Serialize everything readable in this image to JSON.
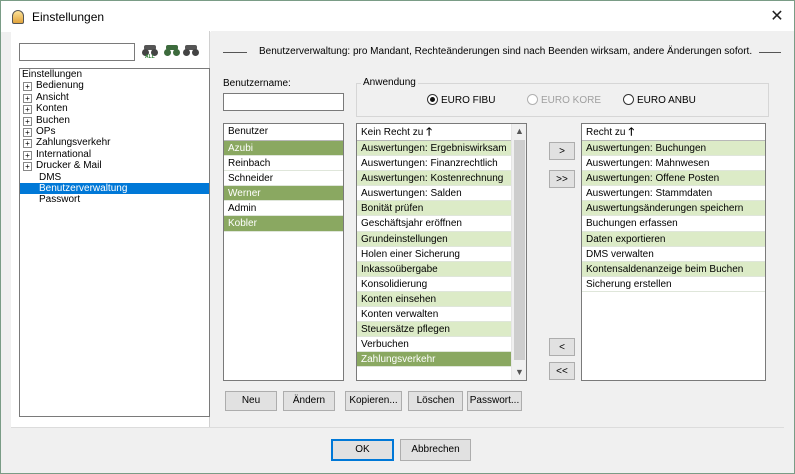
{
  "window": {
    "title": "Einstellungen",
    "close_icon": "✕"
  },
  "left": {
    "search_value": "",
    "search_icons": [
      "binoculars-search-icon",
      "binoculars-next-icon",
      "binoculars-prev-icon"
    ],
    "search_sub_label": "ALL",
    "tree": [
      {
        "label": "Einstellungen",
        "type": "root"
      },
      {
        "label": "Bedienung",
        "type": "node",
        "expander": "+"
      },
      {
        "label": "Ansicht",
        "type": "node",
        "expander": "+"
      },
      {
        "label": "Konten",
        "type": "node",
        "expander": "+"
      },
      {
        "label": "Buchen",
        "type": "node",
        "expander": "+"
      },
      {
        "label": "OPs",
        "type": "node",
        "expander": "+"
      },
      {
        "label": "Zahlungsverkehr",
        "type": "node",
        "expander": "+"
      },
      {
        "label": "International",
        "type": "node",
        "expander": "+"
      },
      {
        "label": "Drucker & Mail",
        "type": "node",
        "expander": "+"
      },
      {
        "label": "DMS",
        "type": "leaf"
      },
      {
        "label": "Benutzerverwaltung",
        "type": "leaf",
        "selected": true
      },
      {
        "label": "Passwort",
        "type": "leaf"
      }
    ]
  },
  "main": {
    "headline": "Benutzerverwaltung: pro Mandant, Rechteänderungen sind nach Beenden wirksam, andere Änderungen sofort.",
    "username_label": "Benutzername:",
    "username_value": "",
    "anwendung_label": "Anwendung",
    "radios": [
      {
        "label": "EURO FIBU",
        "checked": true,
        "disabled": false
      },
      {
        "label": "EURO KORE",
        "checked": false,
        "disabled": true
      },
      {
        "label": "EURO ANBU",
        "checked": false,
        "disabled": false
      }
    ],
    "users_header": "Benutzer",
    "users": [
      {
        "label": "Azubi",
        "hl": true
      },
      {
        "label": "Reinbach",
        "hl": false
      },
      {
        "label": "Schneider",
        "hl": false
      },
      {
        "label": "Werner",
        "hl": true
      },
      {
        "label": "Admin",
        "hl": false
      },
      {
        "label": "Kobler",
        "hl": true
      }
    ],
    "no_right_header": "Kein Recht zu",
    "no_right": [
      {
        "label": "Auswertungen: Ergebniswirksam",
        "hl": "g"
      },
      {
        "label": "Auswertungen: Finanzrechtlich",
        "hl": ""
      },
      {
        "label": "Auswertungen: Kostenrechnung",
        "hl": "g"
      },
      {
        "label": "Auswertungen: Salden",
        "hl": ""
      },
      {
        "label": "Bonität prüfen",
        "hl": "g"
      },
      {
        "label": "Geschäftsjahr eröffnen",
        "hl": ""
      },
      {
        "label": "Grundeinstellungen",
        "hl": "g"
      },
      {
        "label": "Holen einer Sicherung",
        "hl": ""
      },
      {
        "label": "Inkassoübergabe",
        "hl": "g"
      },
      {
        "label": "Konsolidierung",
        "hl": ""
      },
      {
        "label": "Konten einsehen",
        "hl": "g"
      },
      {
        "label": "Konten verwalten",
        "hl": ""
      },
      {
        "label": "Steuersätze pflegen",
        "hl": "g"
      },
      {
        "label": "Verbuchen",
        "hl": ""
      },
      {
        "label": "Zahlungsverkehr",
        "hl": "sel"
      }
    ],
    "right_header": "Recht zu",
    "rights": [
      {
        "label": "Auswertungen: Buchungen",
        "hl": "g"
      },
      {
        "label": "Auswertungen: Mahnwesen",
        "hl": ""
      },
      {
        "label": "Auswertungen: Offene Posten",
        "hl": "g"
      },
      {
        "label": "Auswertungen: Stammdaten",
        "hl": ""
      },
      {
        "label": "Auswertungsänderungen speichern",
        "hl": "g"
      },
      {
        "label": "Buchungen erfassen",
        "hl": ""
      },
      {
        "label": "Daten exportieren",
        "hl": "g"
      },
      {
        "label": "DMS verwalten",
        "hl": ""
      },
      {
        "label": "Kontensaldenanzeige beim Buchen",
        "hl": "g"
      },
      {
        "label": "Sicherung erstellen",
        "hl": ""
      }
    ],
    "move_buttons": [
      ">",
      ">>",
      "<",
      "<<"
    ],
    "user_buttons": [
      "Neu",
      "Ändern",
      "Kopieren...",
      "Löschen",
      "Passwort..."
    ]
  },
  "footer": {
    "ok": "OK",
    "cancel": "Abbrechen"
  },
  "colors": {
    "highlight_light": "#dcebc7",
    "highlight_dark": "#8aa861",
    "selection_blue": "#0078d7"
  }
}
